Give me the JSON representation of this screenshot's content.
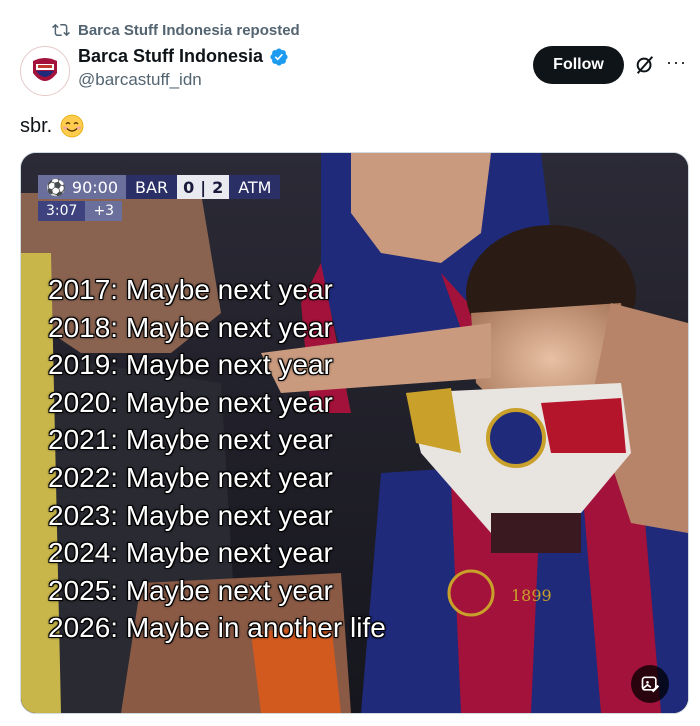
{
  "repost": {
    "text": "Barca Stuff Indonesia reposted"
  },
  "author": {
    "name": "Barca Stuff Indonesia",
    "handle": "@barcastuff_idn",
    "verified_color": "#1d9bf0"
  },
  "follow_label": "Follow",
  "post": {
    "text": "sbr."
  },
  "media": {
    "scoreboard": {
      "clock": "90:00",
      "added_base": "3:07",
      "added_time": "+3",
      "home_team": "BAR",
      "home_score": "0",
      "away_score": "2",
      "away_team": "ATM"
    },
    "lines": [
      "2017: Maybe next year",
      "2018: Maybe next year",
      "2019: Maybe next year",
      "2020: Maybe next year",
      "2021: Maybe next year",
      "2022: Maybe next year",
      "2023: Maybe next year",
      "2024: Maybe next year",
      "2025: Maybe next year",
      "2026: Maybe in another life"
    ],
    "jersey_text": "1899"
  },
  "colors": {
    "follow_bg": "#0f1419",
    "muted": "#536471",
    "barca_blue": "#1f2a7a",
    "barca_red": "#a3123a"
  }
}
